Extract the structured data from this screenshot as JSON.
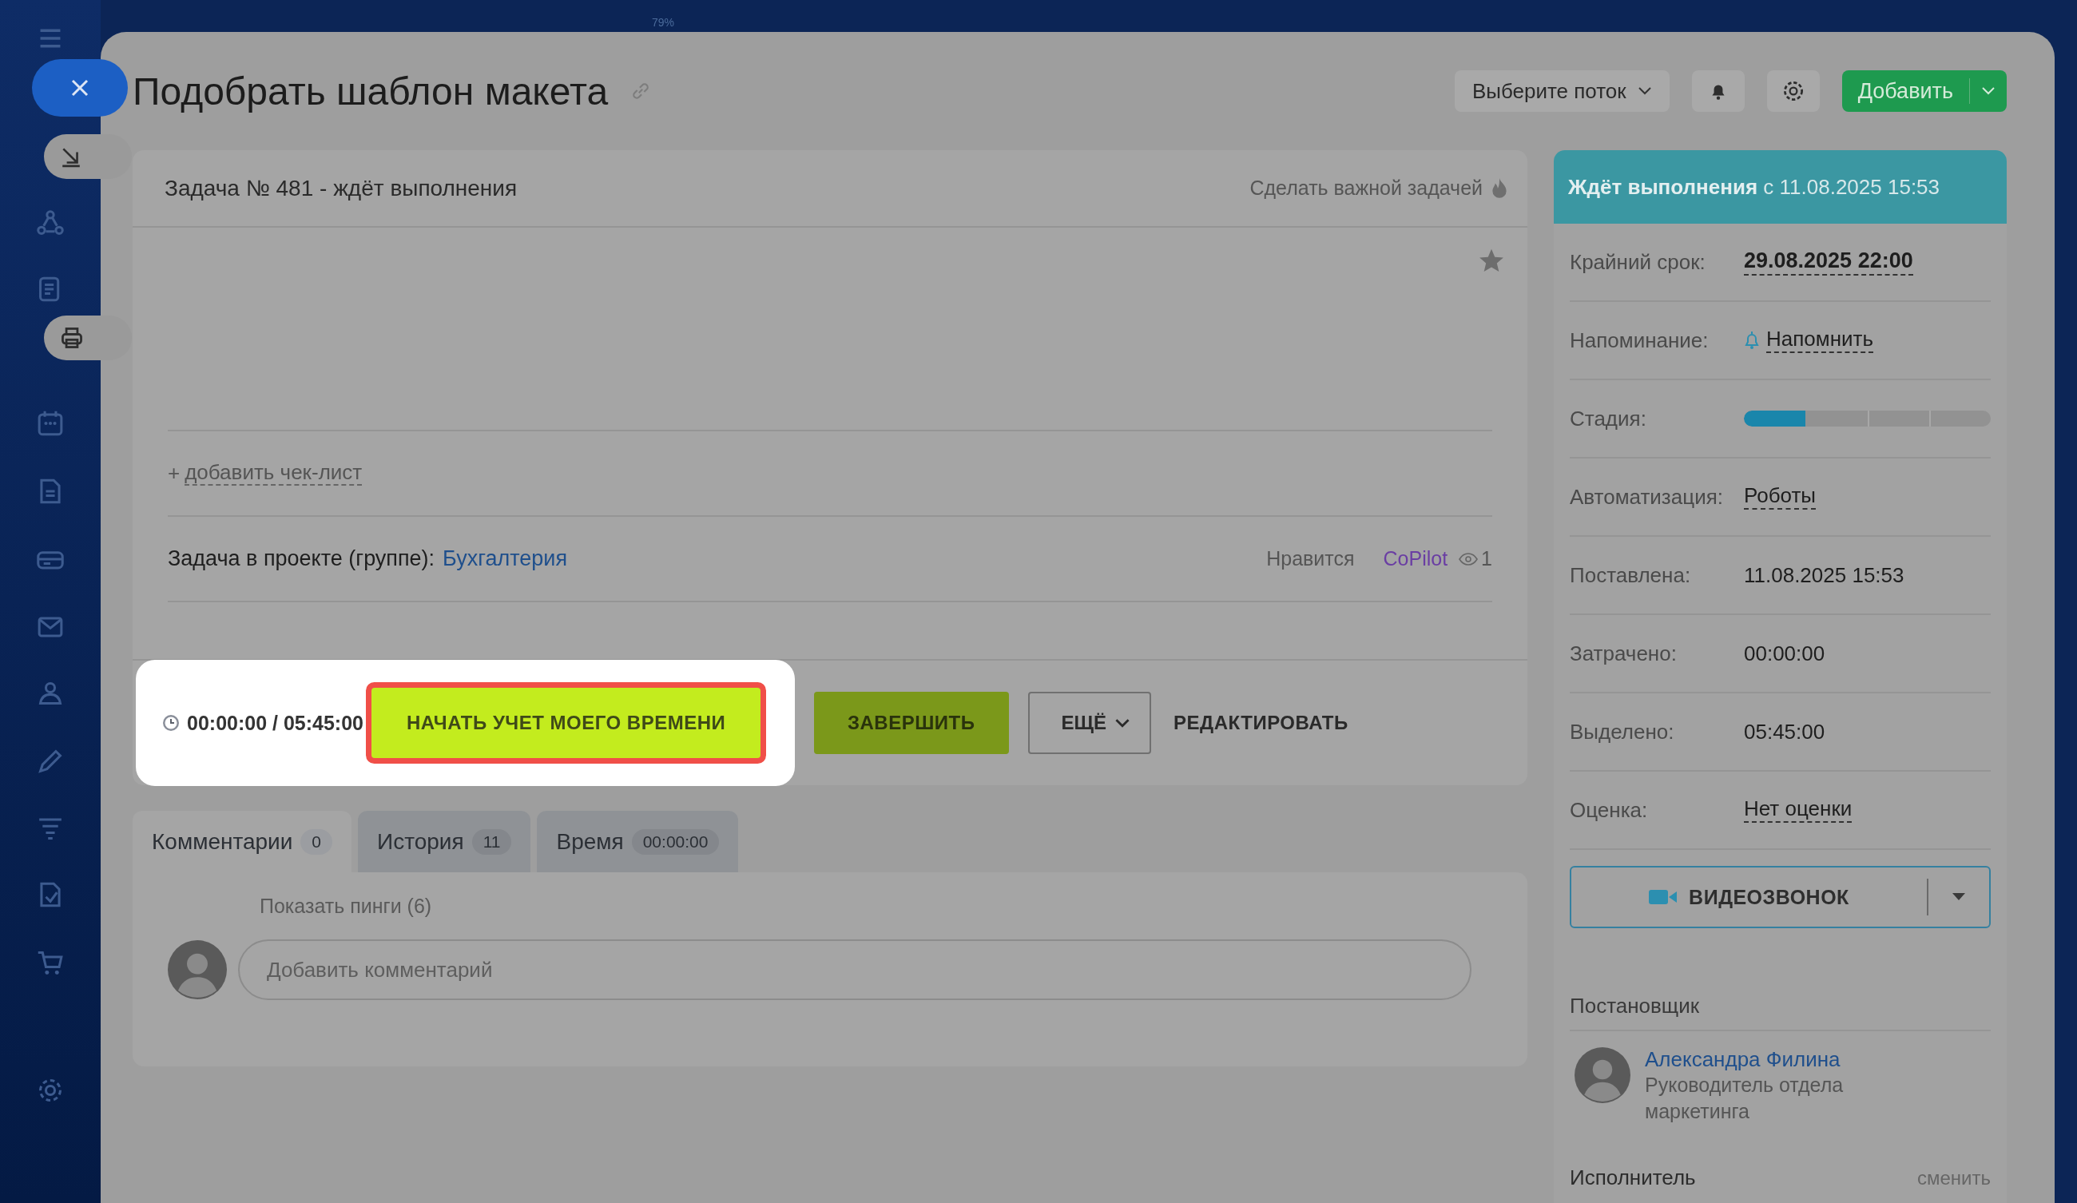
{
  "top_bar": {
    "zoom": "79%"
  },
  "header": {
    "title": "Подобрать шаблон макета",
    "flow_select": "Выберите поток",
    "add_button": "Добавить"
  },
  "task": {
    "heading": "Задача № 481 - ждёт выполнения",
    "important_link": "Сделать важной задачей",
    "checklist_plus": "+",
    "checklist_link": "добавить чек-лист",
    "project_label": "Задача в проекте (группе):",
    "project_name": "Бухгалтерия",
    "likes": "Нравится",
    "copilot": "CoPilot",
    "views": "1",
    "timer": "00:00:00 / 05:45:00",
    "actions": [
      {
        "kind": "start",
        "label": "НАЧАТЬ УЧЕТ МОЕГО ВРЕМЕНИ",
        "highlighted": true
      },
      {
        "kind": "finish",
        "label": "ЗАВЕРШИТЬ"
      },
      {
        "kind": "more",
        "label": "ЕЩЁ"
      },
      {
        "kind": "edit",
        "label": "РЕДАКТИРОВАТЬ"
      }
    ]
  },
  "tabs": [
    {
      "label": "Комментарии",
      "count": "0",
      "selected": true
    },
    {
      "label": "История",
      "count": "11",
      "selected": false
    },
    {
      "label": "Время",
      "count": "00:00:00",
      "selected": false
    }
  ],
  "comments": {
    "pings": "Показать пинги (6)",
    "placeholder": "Добавить комментарий"
  },
  "side_panel": {
    "status": "Ждёт выполнения",
    "since": "с 11.08.2025 15:53",
    "fields": [
      {
        "kind": "link",
        "label": "Крайний срок:",
        "value": "29.08.2025 22:00",
        "bold": true
      },
      {
        "kind": "reminder",
        "label": "Напоминание:",
        "value": "Напомнить",
        "bold": false
      },
      {
        "kind": "stage",
        "label": "Стадия:",
        "level": 0.25
      },
      {
        "kind": "link",
        "label": "Автоматизация:",
        "value": "Роботы",
        "bold": false
      },
      {
        "kind": "text",
        "label": "Поставлена:",
        "value": "11.08.2025 15:53"
      },
      {
        "kind": "text",
        "label": "Затрачено:",
        "value": "00:00:00"
      },
      {
        "kind": "text",
        "label": "Выделено:",
        "value": "05:45:00"
      },
      {
        "kind": "link",
        "label": "Оценка:",
        "value": "Нет оценки",
        "bold": false
      }
    ],
    "video_call": "ВИДЕОЗВОНОК",
    "creator": {
      "heading": "Постановщик",
      "name": "Александра Филина",
      "position": "Руководитель отдела маркетинга"
    },
    "assignee": {
      "heading": "Исполнитель",
      "change": "сменить"
    }
  }
}
